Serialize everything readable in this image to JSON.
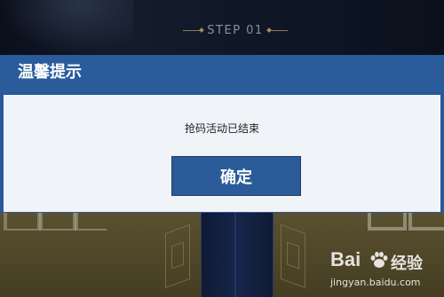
{
  "background": {
    "step_label": "STEP 01"
  },
  "modal": {
    "title": "温馨提示",
    "message": "抢码活动已结束",
    "confirm_label": "确定"
  },
  "watermark": {
    "logo_text": "Bai",
    "logo_text_suffix": "经验",
    "url": "jingyan.baidu.com"
  },
  "colors": {
    "modal_header": "#2a5c9c",
    "modal_body": "#f0f4f8",
    "button": "#2b5b98",
    "background_top": "#0d1526",
    "background_bottom": "#4b4327"
  }
}
